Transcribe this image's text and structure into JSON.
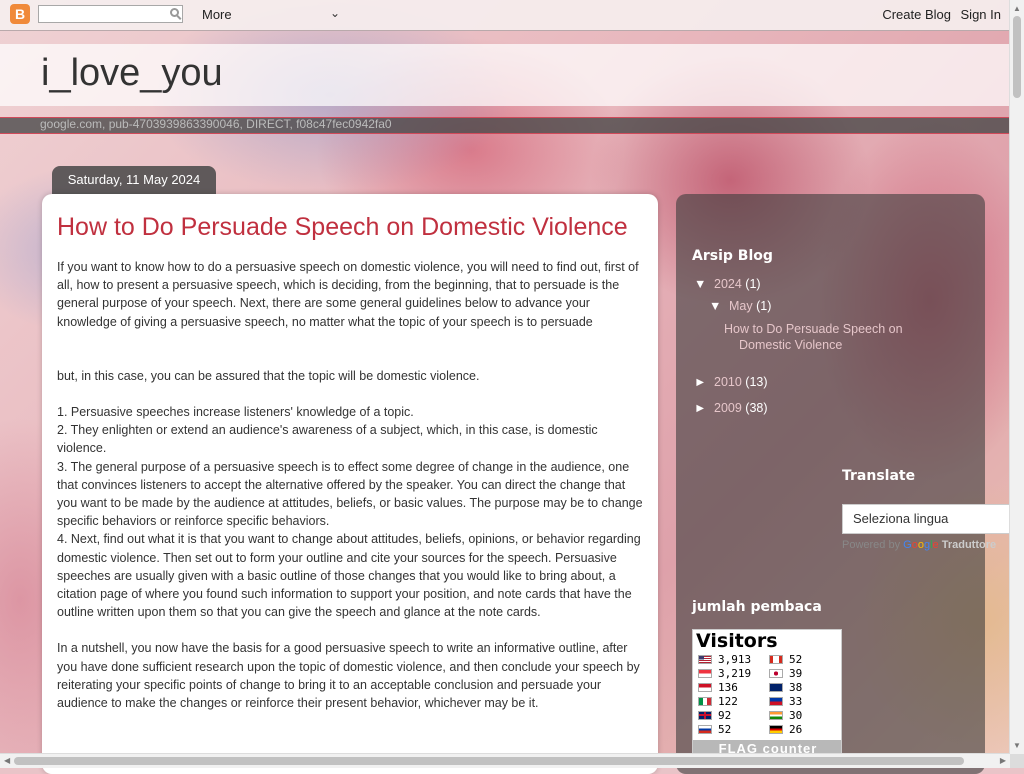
{
  "navbar": {
    "logo_glyph": "B",
    "search_placeholder": "",
    "more_label": "More",
    "chevron": "⌄",
    "create_blog_label": "Create Blog",
    "sign_in_label": "Sign In"
  },
  "header": {
    "blog_title": "i_love_you",
    "ad_text": "google.com, pub-4703939863390046, DIRECT, f08c47fec0942fa0"
  },
  "post": {
    "date": "Saturday, 11 May 2024",
    "title": "How to Do Persuade Speech on Domestic Violence",
    "intro": "If you want to know how to do a persuasive speech on domestic violence, you will need to find out, first of all, how to present a persuasive speech, which is deciding, from the beginning, that to persuade is the general purpose of your speech. Next, there are some general guidelines below to advance your knowledge of giving a persuasive speech, no matter what the topic of your speech is to persuade",
    "line2": "but, in this case, you can be assured that the topic will be domestic violence.",
    "item1": "1. Persuasive speeches increase listeners' knowledge of a topic.",
    "item2": "2. They enlighten or extend an audience's awareness of a subject, which, in this case, is domestic violence.",
    "item3": "3. The general purpose of a persuasive speech is to effect some degree of change in the audience, one that convinces listeners to accept the alternative offered by the speaker. You can direct the change that you want to be made by the audience at attitudes, beliefs, or basic values. The purpose may be to change specific behaviors or reinforce specific behaviors.",
    "item4": "4. Next, find out what it is that you want to change about attitudes, beliefs, opinions, or behavior regarding domestic violence. Then set out to form your outline and cite your sources for the speech. Persuasive speeches are usually given with a basic outline of those changes that you would like to bring about, a citation page of where you found such information to support your position, and note cards that have the outline written upon them so that you can give the speech and glance at the note cards.",
    "conclusion": "In a nutshell, you now have the basis for a good persuasive speech to write an informative outline, after you have done sufficient research upon the topic of domestic violence, and then conclude your speech by reiterating your specific points of change to bring it to an acceptable conclusion and persuade your audience to make the changes or reinforce their present behavior, whichever may be it."
  },
  "sidebar": {
    "archive_heading": "Arsip Blog",
    "archive": {
      "y2024": {
        "tri": "▼",
        "label": "2024",
        "count": "(1)"
      },
      "may": {
        "tri": "▼",
        "label": "May",
        "count": "(1)"
      },
      "post_link": "How to Do Persuade Speech on Domestic Violence",
      "y2010": {
        "tri": "►",
        "label": "2010",
        "count": "(13)"
      },
      "y2009": {
        "tri": "►",
        "label": "2009",
        "count": "(38)"
      }
    },
    "translate_heading": "Translate",
    "language_select": "Seleziona lingua",
    "powered_by": "Powered by",
    "google": [
      "G",
      "o",
      "o",
      "g",
      "l",
      "e"
    ],
    "translate_brand": "Traduttore",
    "readers_heading": "jumlah pembaca",
    "flag_counter": {
      "title": "Visitors",
      "left": [
        {
          "flag": "us",
          "count": "3,913"
        },
        {
          "flag": "sg",
          "count": "3,219"
        },
        {
          "flag": "id",
          "count": "136"
        },
        {
          "flag": "it",
          "count": "122"
        },
        {
          "flag": "gb",
          "count": "92"
        },
        {
          "flag": "ru",
          "count": "52"
        }
      ],
      "right": [
        {
          "flag": "ca",
          "count": "52"
        },
        {
          "flag": "jp",
          "count": "39"
        },
        {
          "flag": "au",
          "count": "38"
        },
        {
          "flag": "ph",
          "count": "33"
        },
        {
          "flag": "in",
          "count": "30"
        },
        {
          "flag": "de",
          "count": "26"
        }
      ],
      "footer": "FLAG counter"
    }
  },
  "colors": {
    "title_red": "#c0303f",
    "link_pink": "#e6c6ca",
    "blogger_orange": "#f08a3a"
  }
}
